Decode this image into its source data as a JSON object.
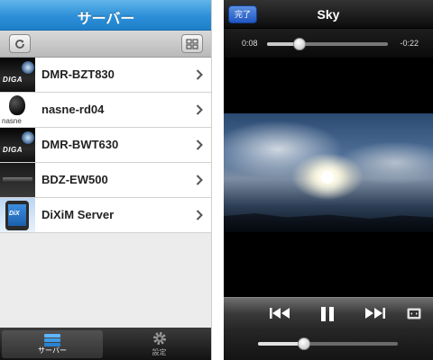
{
  "left_app": {
    "nav_title": "サーバー",
    "servers": [
      {
        "name": "DMR-BZT830",
        "thumb": "diga",
        "thumb_text": "DIGA"
      },
      {
        "name": "nasne-rd04",
        "thumb": "nasne",
        "thumb_text": "nasne"
      },
      {
        "name": "DMR-BWT630",
        "thumb": "diga",
        "thumb_text": "DIGA"
      },
      {
        "name": "BDZ-EW500",
        "thumb": "bdz",
        "thumb_text": ""
      },
      {
        "name": "DiXiM Server",
        "thumb": "dixim",
        "thumb_text": "DiX"
      }
    ],
    "tabs": [
      {
        "label": "サーバー",
        "icon": "server-icon",
        "active": true
      },
      {
        "label": "設定",
        "icon": "gear-icon",
        "active": false
      }
    ],
    "toolbar_icons": [
      "refresh-icon",
      "grid-icon"
    ]
  },
  "right_app": {
    "done_label": "完了",
    "title": "Sky",
    "elapsed": "0:08",
    "remaining": "-0:22",
    "progress_fraction": 0.27,
    "volume_fraction": 0.33,
    "controls": [
      "rewind-icon",
      "pause-icon",
      "fast-forward-icon",
      "aspect-ratio-icon"
    ]
  },
  "colors": {
    "nav_blue": "#2c8fd8",
    "done_blue": "#2057c4"
  }
}
